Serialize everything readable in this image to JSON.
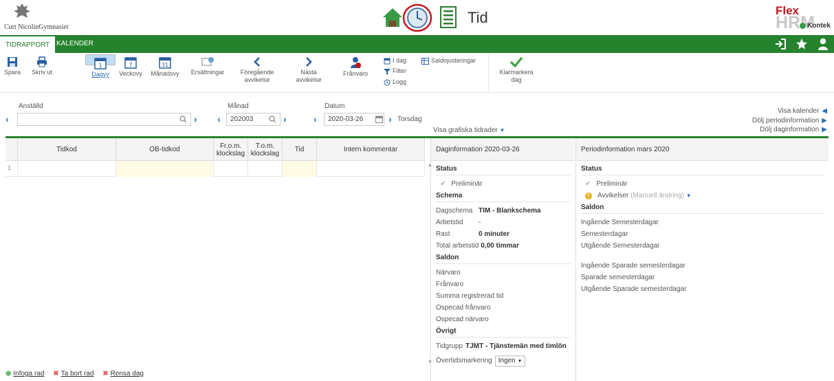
{
  "header": {
    "school_name": "Curt NicolinGymnasiet",
    "title": "Tid",
    "brand": {
      "flex": "Flex",
      "hrm": "HRM",
      "kontek": "Kontek"
    }
  },
  "tabs": [
    {
      "label": "TIDRAPPORT",
      "active": true
    },
    {
      "label": "KALENDER",
      "active": false
    }
  ],
  "toolbar": {
    "spara": "Spara",
    "skriv_ut": "Skriv ut",
    "dagvy": "Dagvy",
    "dagvy_num": "1",
    "veckovy": "Veckovy",
    "veckovy_num": "7",
    "manadsvy": "Månadsvy",
    "manadsvy_num": "31",
    "ersattningar": "Ersättningar",
    "foregaende_1": "Föregående",
    "foregaende_2": "avvikelse",
    "nasta_1": "Nästa",
    "nasta_2": "avvikelse",
    "franvaro": "Frånvaro",
    "idag": "I dag",
    "filter": "Filter",
    "logg": "Logg",
    "saldojusteringar": "Saldojusteringar",
    "klarmarkera_1": "Klarmarkera",
    "klarmarkera_2": "dag"
  },
  "filters": {
    "anstalld_label": "Anställd",
    "anstalld_value": "",
    "manad_label": "Månad",
    "manad_value": "202003",
    "datum_label": "Datum",
    "datum_value": "2020-03-26",
    "weekday": "Torsdag",
    "visa_grafiska": "Visa grafiska tidrader",
    "visa_kalender": "Visa kalender",
    "dolj_period": "Dölj periodinformation",
    "dolj_dag": "Dölj daginformation"
  },
  "table": {
    "columns": [
      "Tidkod",
      "OB-tidkod",
      "Fr.o.m. klockslag",
      "T.o.m. klockslag",
      "Tid",
      "Intern kommentar"
    ],
    "row_number": "1",
    "footer": {
      "infoga": "Infoga rad",
      "ta_bort": "Ta bort rad",
      "rensa": "Rensa dag"
    }
  },
  "dayinfo": {
    "title": "Daginformation 2020-03-26",
    "status_h": "Status",
    "preliminar": "Preliminär",
    "schema_h": "Schema",
    "dagschema_k": "Dagschema",
    "dagschema_v": "TIM - Blankschema",
    "arbetstid_k": "Arbetstid",
    "arbetstid_v": "-",
    "rast_k": "Rast",
    "rast_v": "0 minuter",
    "total_k": "Total arbetstid",
    "total_v": "0,00 timmar",
    "saldon_h": "Saldon",
    "narvaro": "Närvaro",
    "franvaro": "Frånvaro",
    "summa": "Summa registrerad tid",
    "ospecad_franvaro": "Ospecad frånvaro",
    "ospecad_narvaro": "Ospecad närvaro",
    "ovrigt_h": "Övrigt",
    "tidgrupp_k": "Tidgrupp",
    "tidgrupp_v": "TJMT - Tjänstemän med timlön",
    "overtid_k": "Övertidsmarkering",
    "overtid_v": "Ingen"
  },
  "periodinfo": {
    "title": "Periodinformation mars 2020",
    "status_h": "Status",
    "preliminar": "Preliminär",
    "avvikelser": "Avvikelser",
    "avvikelser_note": "(Manuell ändring)",
    "saldon_h": "Saldon",
    "items_1": [
      "Ingående Semesterdagar",
      "Semesterdagar",
      "Utgående Semesterdagar"
    ],
    "items_2": [
      "Ingående Sparade semesterdagar",
      "Sparade semesterdagar",
      "Utgående Sparade semesterdagar"
    ]
  },
  "colors": {
    "green": "#25832d",
    "blue": "#2a6ebd",
    "selected": "#bfdcf2"
  }
}
